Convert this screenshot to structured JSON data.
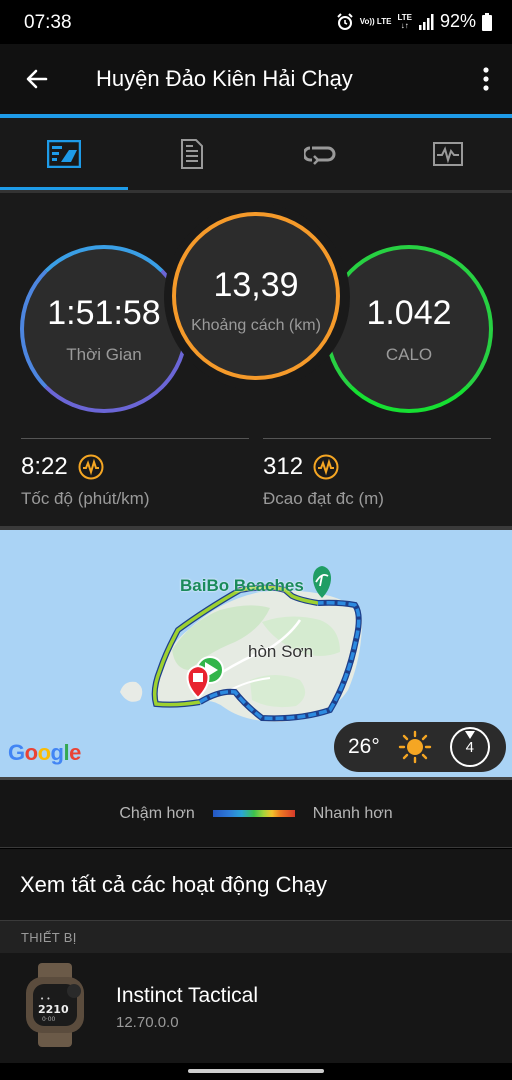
{
  "status_bar": {
    "time": "07:38",
    "volte": "Vo)) LTE",
    "lte": "LTE",
    "battery": "92%",
    "icons": [
      "alarm-icon",
      "signal-icon",
      "battery-icon"
    ]
  },
  "app_bar": {
    "title": "Huyện Đảo Kiên Hải Chạy",
    "back_icon": "back-arrow-icon",
    "more_icon": "more-vertical-icon"
  },
  "tabs": [
    {
      "icon": "stats-icon",
      "active": true
    },
    {
      "icon": "laps-icon",
      "active": false
    },
    {
      "icon": "splits-icon",
      "active": false
    },
    {
      "icon": "chart-icon",
      "active": false
    }
  ],
  "stats": {
    "time": {
      "value": "1:51:58",
      "label": "Thời Gian"
    },
    "distance": {
      "value": "13,39",
      "label": "Khoảng cách (km)"
    },
    "calories": {
      "value": "1.042",
      "label": "CALO"
    },
    "pace": {
      "value": "8:22",
      "label": "Tốc độ (phút/km)"
    },
    "elevation": {
      "value": "312",
      "label": "Đcao đạt đc (m)"
    }
  },
  "map": {
    "place_beach": "BaiBo Beaches",
    "place_island": "hòn Sơn",
    "temperature": "26°",
    "wind_speed": "4",
    "attribution": "Google"
  },
  "legend": {
    "slower": "Chậm hơn",
    "faster": "Nhanh hơn"
  },
  "view_all": "Xem tất cả các hoạt động Chạy",
  "section_header": "THIẾT BỊ",
  "device": {
    "name": "Instinct Tactical",
    "version": "12.70.0.0"
  },
  "colors": {
    "accent": "#1e9be8",
    "time_ring": "#6b66d6",
    "distance_ring": "#f59a2a",
    "calorie_ring": "#27d142"
  }
}
